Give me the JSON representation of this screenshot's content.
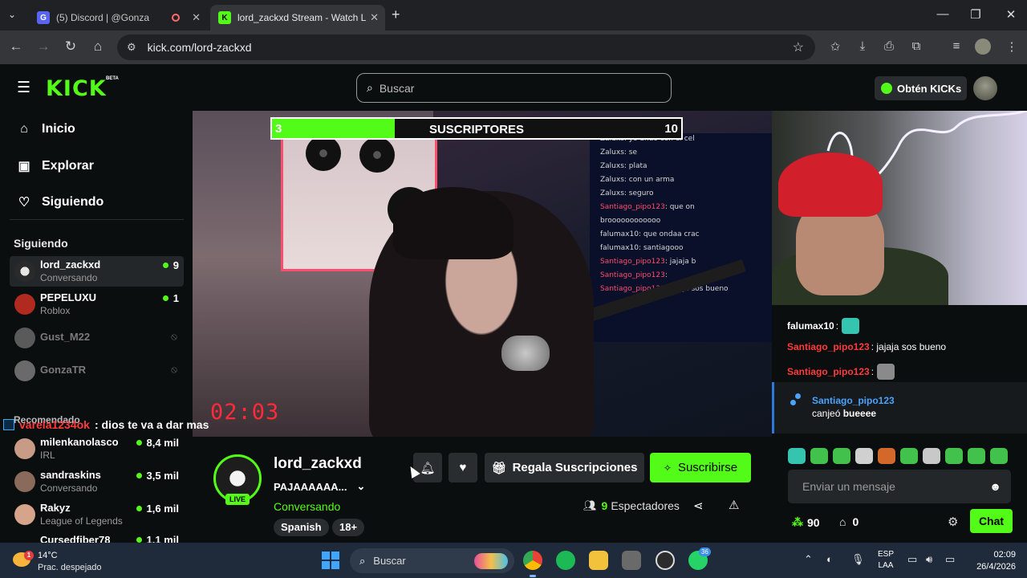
{
  "browser": {
    "tabs": [
      {
        "title": "(5) Discord | @Gonza",
        "active": false
      },
      {
        "title": "lord_zackxd Stream - Watch Liv",
        "active": true
      }
    ],
    "url": "kick.com/lord-zackxd"
  },
  "header": {
    "logo": "KICK",
    "logo_badge": "BETA",
    "search_placeholder": "Buscar",
    "get_kicks_label": "Obtén KICKs"
  },
  "sidebar": {
    "nav": [
      {
        "label": "Inicio",
        "icon": "home-icon"
      },
      {
        "label": "Explorar",
        "icon": "compass-icon"
      },
      {
        "label": "Siguiendo",
        "icon": "heart-icon"
      }
    ],
    "following_heading": "Siguiendo",
    "following": [
      {
        "name": "lord_zackxd",
        "category": "Conversando",
        "viewers": "9",
        "live": true
      },
      {
        "name": "PEPELUXU",
        "category": "Roblox",
        "viewers": "1",
        "live": true
      },
      {
        "name": "Gust_M22",
        "live": false
      },
      {
        "name": "GonzaTR",
        "live": false
      }
    ],
    "recommended_heading": "Recomendado",
    "recommended": [
      {
        "name": "milenkanolasco",
        "category": "IRL",
        "viewers": "8,4 mil"
      },
      {
        "name": "sandraskins",
        "category": "Conversando",
        "viewers": "3,5 mil"
      },
      {
        "name": "Rakyz",
        "category": "League of Legends",
        "viewers": "1,6 mil"
      },
      {
        "name": "Cursedfiber78",
        "viewers": "1,1 mil"
      }
    ]
  },
  "video": {
    "sub_goal": {
      "current": "3",
      "label": "SUSCRIPTORES",
      "max": "10",
      "progress": 0.3
    },
    "timer": "02:03",
    "overlay_message": {
      "user": "varela1234ok",
      "text": ": dios te va a dar mas"
    },
    "in_video_chat": [
      {
        "user": "Zaluxs",
        "text": ": yo ando con el cel"
      },
      {
        "user": "Zaluxs",
        "text": ": se"
      },
      {
        "user": "Zaluxs",
        "text": ": plata"
      },
      {
        "user": "Zaluxs",
        "text": ": con un arma"
      },
      {
        "user": "Zaluxs",
        "text": ": seguro"
      },
      {
        "user": "Santiago_pipo123",
        "text": ": que on"
      },
      {
        "user": "",
        "text": "broooooooooooo"
      },
      {
        "user": "falumax10",
        "text": ": que ondaa crac"
      },
      {
        "user": "falumax10",
        "text": ": santiagooo"
      },
      {
        "user": "Santiago_pipo123",
        "text": ": jajaja b"
      },
      {
        "user": "Santiago_pipo123",
        "text": ":"
      },
      {
        "user": "Santiago_pipo123",
        "text": ": jajaja sos bueno"
      }
    ]
  },
  "channel": {
    "name": "lord_zackxd",
    "live_badge": "LIVE",
    "title": "PAJAAAAAA...",
    "category": "Conversando",
    "tags": [
      "Spanish",
      "18+"
    ],
    "gift_label": "Regala Suscripciones",
    "subscribe_label": "Suscribirse",
    "viewer_count": "9",
    "viewer_label": "Espectadores"
  },
  "chat": {
    "messages": [
      {
        "user": "falumax10",
        "user_color": "#ffffff",
        "text": ":",
        "emote": true
      },
      {
        "user": "Santiago_pipo123",
        "user_color": "#ff3b3b",
        "text": ": jajaja sos bueno",
        "emote": false
      },
      {
        "user": "Santiago_pipo123",
        "user_color": "#ff3b3b",
        "text": ":",
        "emote": true
      }
    ],
    "redeem": {
      "user": "Santiago_pipo123",
      "action": "canjeó",
      "item": "bueeee"
    },
    "input_placeholder": "Enviar un mensaje",
    "points": "90",
    "store_count": "0",
    "send_label": "Chat"
  },
  "taskbar": {
    "weather_temp": "14°C",
    "weather_desc": "Prac. despejado",
    "weather_badge": "1",
    "search_placeholder": "Buscar",
    "whatsapp_badge": "36",
    "lang_line1": "ESP",
    "lang_line2": "LAA",
    "time": "02:09",
    "date": "26/4/2026"
  },
  "colors": {
    "accent": "#53fc18",
    "background": "#0b0e0f",
    "username_red": "#ff3b3b",
    "redeem_blue": "#4aa3ff"
  }
}
